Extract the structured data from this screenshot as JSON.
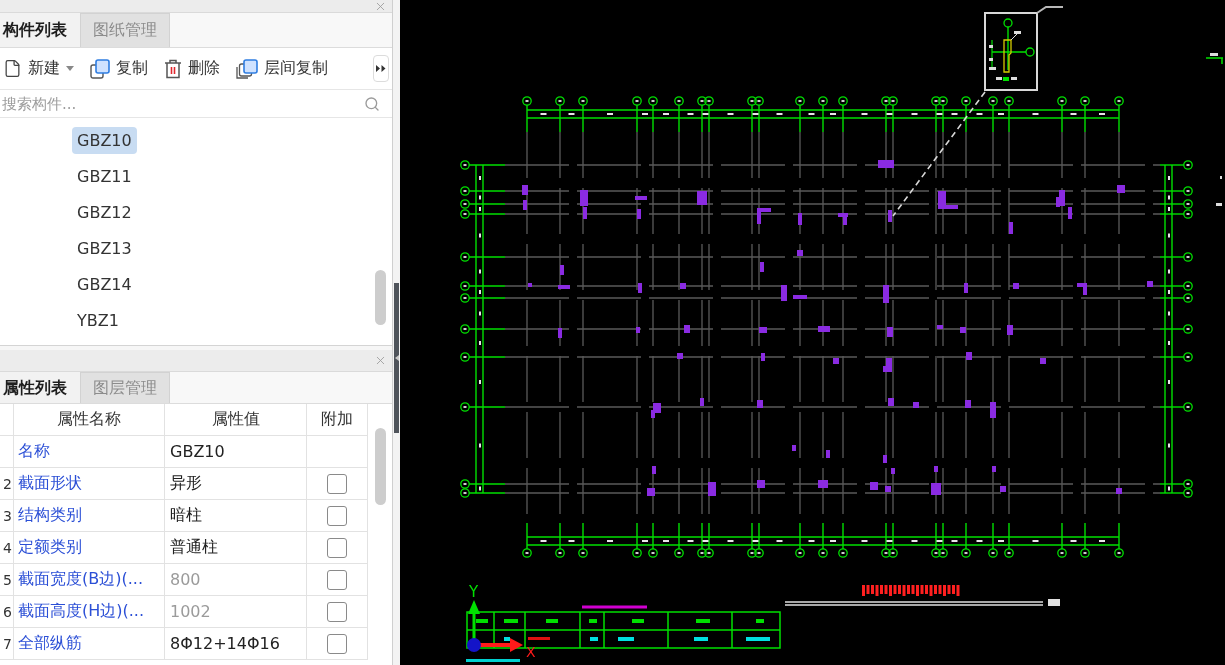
{
  "component_panel": {
    "tabs": [
      {
        "label": "构件列表",
        "selected": true
      },
      {
        "label": "图纸管理",
        "selected": false
      }
    ],
    "toolbar": [
      {
        "kind": "new",
        "label": "新建",
        "has_menu": true
      },
      {
        "kind": "copy",
        "label": "复制",
        "has_menu": false
      },
      {
        "kind": "delete",
        "label": "删除",
        "has_menu": false
      },
      {
        "kind": "layercopy",
        "label": "层间复制",
        "has_menu": false
      },
      {
        "kind": "more",
        "has_menu": false
      }
    ],
    "search": {
      "placeholder": "搜索构件..."
    },
    "items": [
      {
        "label": "GBZ10",
        "selected": true
      },
      {
        "label": "GBZ11",
        "selected": false
      },
      {
        "label": "GBZ12",
        "selected": false
      },
      {
        "label": "GBZ13",
        "selected": false
      },
      {
        "label": "GBZ14",
        "selected": false
      },
      {
        "label": "YBZ1",
        "selected": false
      }
    ]
  },
  "property_panel": {
    "tabs": [
      {
        "label": "属性列表",
        "selected": true
      },
      {
        "label": "图层管理",
        "selected": false
      }
    ],
    "table": {
      "columns": [
        "属性名称",
        "属性值",
        "附加"
      ],
      "rows": [
        {
          "kind": "plain",
          "name": "名称",
          "value": "GBZ10",
          "disabled": false
        },
        {
          "kind": "option",
          "number": "2",
          "name": "截面形状",
          "value": "异形",
          "disabled": false,
          "checked": false
        },
        {
          "kind": "option",
          "number": "3",
          "name": "结构类别",
          "value": "暗柱",
          "disabled": false,
          "checked": false
        },
        {
          "kind": "option",
          "number": "4",
          "name": "定额类别",
          "value": "普通柱",
          "disabled": false,
          "checked": false
        },
        {
          "kind": "option",
          "number": "5",
          "name": "截面宽度(B边)(...",
          "value": "800",
          "disabled": true,
          "checked": false
        },
        {
          "kind": "option",
          "number": "6",
          "name": "截面高度(H边)(...",
          "value": "1002",
          "disabled": true,
          "checked": false
        },
        {
          "kind": "option",
          "number": "7",
          "name": "全部纵筋",
          "value": "8Φ12+14Φ16",
          "disabled": false,
          "checked": false
        }
      ]
    }
  },
  "drawing": {
    "axes": {
      "y_label": "Y",
      "x_label": "X"
    }
  }
}
